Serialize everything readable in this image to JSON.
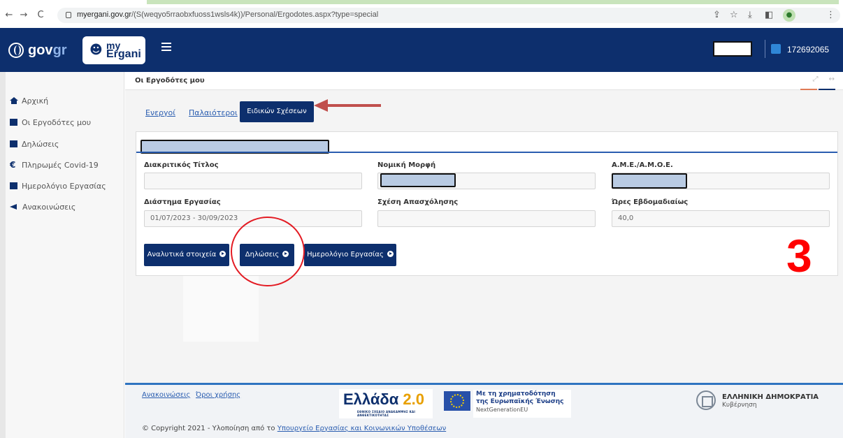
{
  "browser": {
    "url_domain": "myergani.gov.gr",
    "url_path": "/(S(weqyo5rraobxfuoss1wsls4k))/Personal/Ergodotes.aspx?type=special",
    "back": "←",
    "forward": "→",
    "reload": "C"
  },
  "header": {
    "gov_logo_text": "gov",
    "gov_logo_suffix": "gr",
    "ergani_my": "my",
    "ergani_name": "Ergani",
    "user_id": "172692065"
  },
  "sidebar": {
    "items": [
      {
        "label": "Αρχική",
        "icon": "home-icon"
      },
      {
        "label": "Οι Εργοδότες μου",
        "icon": "building-icon"
      },
      {
        "label": "Δηλώσεις",
        "icon": "document-icon"
      },
      {
        "label": "Πληρωμές Covid-19",
        "icon": "euro-icon"
      },
      {
        "label": "Ημερολόγιο Εργασίας",
        "icon": "calendar-icon"
      },
      {
        "label": "Ανακοινώσεις",
        "icon": "megaphone-icon"
      }
    ]
  },
  "main": {
    "breadcrumb": "Οι Εργοδότες μου",
    "tabs": [
      {
        "label": "Ενεργοί",
        "active": false
      },
      {
        "label": "Παλαιότεροι",
        "active": false
      },
      {
        "label": "Ειδικών Σχέσεων",
        "active": true
      }
    ],
    "fields": {
      "distinctive_title_label": "Διακριτικός Τίτλος",
      "distinctive_title_value": "",
      "legal_form_label": "Νομική Μορφή",
      "ame_label": "Α.Μ.Ε./Α.Μ.Ο.Ε.",
      "work_period_label": "Διάστημα Εργασίας",
      "work_period_value": "01/07/2023 - 30/09/2023",
      "employment_relation_label": "Σχέση Απασχόλησης",
      "employment_relation_value": "",
      "weekly_hours_label": "Ώρες Εβδομαδιαίως",
      "weekly_hours_value": "40,0"
    },
    "actions": {
      "details_label": "Αναλυτικά στοιχεία",
      "declarations_label": "Δηλώσεις",
      "work_calendar_label": "Ημερολόγιο Εργασίας"
    },
    "annotation_number": "3",
    "annotation_color": "#ff0000"
  },
  "footer": {
    "links": [
      "Ανακοινώσεις",
      "Όροι χρήσης"
    ],
    "ellada_title": "Ελλάδα",
    "ellada_version": "2.0",
    "ellada_sub": "ΕΘΝΙΚΟ ΣΧΕΔΙΟ ΑΝΑΚΑΜΨΗΣ ΚΑΙ ΑΝΘΕΚΤΙΚΟΤΗΤΑΣ",
    "eu_line1": "Με τη χρηματοδότηση",
    "eu_line2": "της Ευρωπαϊκής Ένωσης",
    "eu_line3": "NextGenerationEU",
    "gov_title": "ΕΛΛΗΝΙΚΗ ΔΗΜΟΚΡΑΤΙΑ",
    "gov_sub": "Κυβέρνηση",
    "copyright_prefix": "© Copyright 2021 - Υλοποίηση από το",
    "copyright_link": "Υπουργείο Εργασίας και Κοινωνικών Υποθέσεων"
  },
  "colors": {
    "brand_navy": "#0d2f6d",
    "link_blue": "#2a5db0",
    "annotation_red": "#e31b23"
  }
}
